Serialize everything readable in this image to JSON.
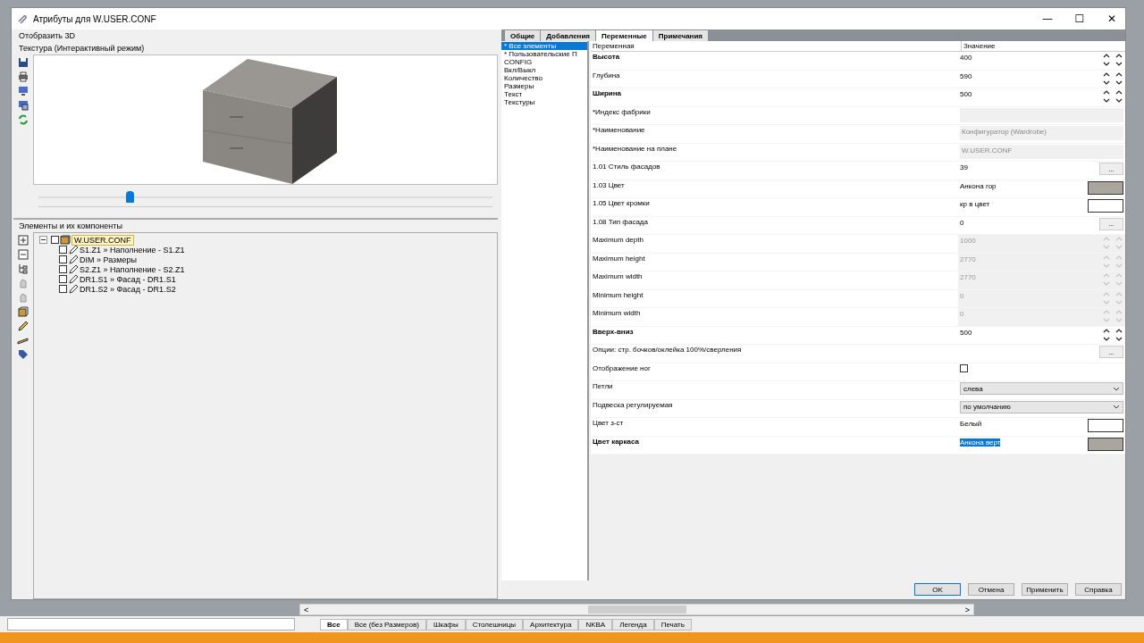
{
  "window": {
    "title": "Атрибуты для W.USER.CONF",
    "minimize": "—",
    "maximize": "☐",
    "close": "✕"
  },
  "left_panel": {
    "view_label": "Отобразить 3D",
    "preview_label": "Текстура (Интерактивный режим)",
    "zoom_slider": {
      "level": 0.2
    },
    "tree_label": "Элементы и их компоненты",
    "tree": [
      {
        "label": "W.USER.CONF",
        "checked": false,
        "selected": true,
        "expanded": true,
        "children": [
          {
            "label": "S1.Z1 » Наполнение - S1.Z1",
            "checked": false,
            "selected": false
          },
          {
            "label": "DIM » Размеры",
            "checked": false,
            "selected": false
          },
          {
            "label": "S2.Z1 » Наполнение - S2.Z1",
            "checked": false,
            "selected": false
          },
          {
            "label": "DR1.S1 » Фасад - DR1.S1",
            "checked": false,
            "selected": false
          },
          {
            "label": "DR1.S2 » Фасад - DR1.S2",
            "checked": false,
            "selected": false
          }
        ]
      }
    ]
  },
  "tabs": [
    {
      "label": "Общие",
      "selected": false
    },
    {
      "label": "Добавления",
      "selected": false
    },
    {
      "label": "Переменные",
      "selected": true
    },
    {
      "label": "Примечания",
      "selected": false
    }
  ],
  "categories": [
    {
      "label": "* Все элементы",
      "selected": true
    },
    {
      "label": "* Пользовательские П",
      "selected": false
    },
    {
      "label": "CONFIG",
      "selected": false
    },
    {
      "label": "Вкл/Выкл",
      "selected": false
    },
    {
      "label": "Количество",
      "selected": false
    },
    {
      "label": "Размеры",
      "selected": false
    },
    {
      "label": "Текст",
      "selected": false
    },
    {
      "label": "Текстуры",
      "selected": false
    }
  ],
  "table": {
    "columns": [
      "Переменная",
      "Значение"
    ],
    "rows": [
      {
        "label": "Высота",
        "bold": true,
        "kind": "spin",
        "value": "400",
        "disabled": false
      },
      {
        "label": "Глубина",
        "bold": false,
        "kind": "spin",
        "value": "590",
        "disabled": false
      },
      {
        "label": "Ширина",
        "bold": true,
        "kind": "spin",
        "value": "500",
        "disabled": false
      },
      {
        "label": "*Индекс фабрики",
        "bold": false,
        "kind": "field",
        "disabled": true
      },
      {
        "label": "*Наименование",
        "bold": false,
        "kind": "field",
        "value": "Конфигуратор (Wardrobe)",
        "disabled": true
      },
      {
        "label": "*Наименование на плане",
        "bold": false,
        "kind": "field",
        "value": "W.USER.CONF",
        "disabled": true
      },
      {
        "label": "1.01 Стиль фасадов",
        "bold": false,
        "kind": "button",
        "value": "39",
        "button": "..."
      },
      {
        "label": "1.03 Цвет",
        "bold": false,
        "kind": "color",
        "value": "Анкона гор",
        "color": "#aaa59d",
        "selected": false
      },
      {
        "label": "1.05 Цвет кромки",
        "bold": false,
        "kind": "color",
        "value": "кр в цвет",
        "color": "#ffffff",
        "selected": false
      },
      {
        "label": "1.08 Тип фасада",
        "bold": false,
        "kind": "button",
        "value": "0",
        "button": "..."
      },
      {
        "label": "Maximum depth",
        "bold": false,
        "kind": "spin",
        "value": "1000",
        "disabled": true
      },
      {
        "label": "Maximum height",
        "bold": false,
        "kind": "spin",
        "value": "2770",
        "disabled": true
      },
      {
        "label": "Maximum width",
        "bold": false,
        "kind": "spin",
        "value": "2770",
        "disabled": true
      },
      {
        "label": "Minimum height",
        "bold": false,
        "kind": "spin",
        "value": "0",
        "disabled": true
      },
      {
        "label": "Minimum width",
        "bold": false,
        "kind": "spin",
        "value": "0",
        "disabled": true
      },
      {
        "label": "Вверх-вниз",
        "bold": true,
        "kind": "spin",
        "value": "500",
        "disabled": false
      },
      {
        "label": "Опции: стр. бочков/оклейка 100%/сверления",
        "bold": false,
        "kind": "button",
        "button": "..."
      },
      {
        "label": "Отображение ног",
        "bold": false,
        "kind": "checkbox",
        "checked": false
      },
      {
        "label": "Петли",
        "bold": false,
        "kind": "dropdown",
        "value": "слева"
      },
      {
        "label": "Подвеска регулируемая",
        "bold": false,
        "kind": "dropdown",
        "value": "по умолчанию"
      },
      {
        "label": "Цвет з-ст",
        "bold": false,
        "kind": "color",
        "value": "Белый",
        "color": "#ffffff",
        "selected": false
      },
      {
        "label": "Цвет каркаса",
        "bold": true,
        "kind": "color",
        "value": "Анкона верт",
        "color": "#aaa59d",
        "selected": true
      }
    ]
  },
  "buttons": [
    {
      "label": "OK",
      "default": true
    },
    {
      "label": "Отмена",
      "default": false
    },
    {
      "label": "Применить",
      "default": false
    },
    {
      "label": "Справка",
      "default": false
    }
  ],
  "sheet_tabs": [
    {
      "label": "Все",
      "selected": true
    },
    {
      "label": "Все (без Размеров)",
      "selected": false
    },
    {
      "label": "Шкафы",
      "selected": false
    },
    {
      "label": "Столешницы",
      "selected": false
    },
    {
      "label": "Архитектура",
      "selected": false
    },
    {
      "label": "NKBA",
      "selected": false
    },
    {
      "label": "Легенда",
      "selected": false
    },
    {
      "label": "Печать",
      "selected": false
    }
  ],
  "scroll_left": "<",
  "scroll_right": ">"
}
